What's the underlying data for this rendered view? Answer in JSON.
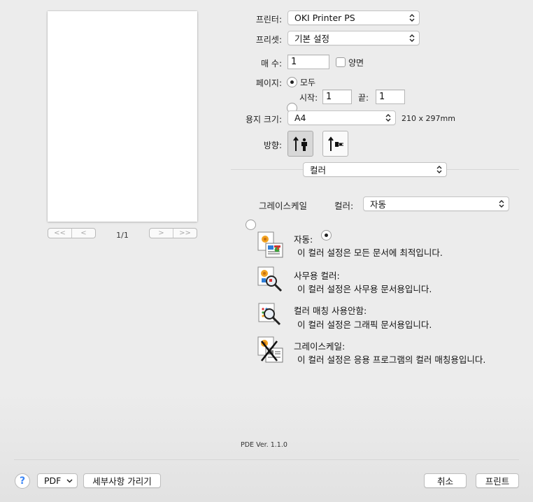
{
  "preview": {
    "page_indicator": "1/1",
    "first_label": "<<",
    "prev_label": "<",
    "next_label": ">",
    "last_label": ">>"
  },
  "printer": {
    "label": "프린터:",
    "value": "OKI Printer PS"
  },
  "preset": {
    "label": "프리셋:",
    "value": "기본 설정"
  },
  "copies": {
    "label": "매 수:",
    "value": "1",
    "duplex_label": "양면"
  },
  "pages": {
    "label": "페이지:",
    "all_label": "모두",
    "from_label": "시작:",
    "from_value": "1",
    "to_label": "끝:",
    "to_value": "1"
  },
  "paper": {
    "label": "용지 크기:",
    "value": "A4",
    "size_text": "210 x 297mm"
  },
  "orientation": {
    "label": "방향:"
  },
  "section": {
    "value": "컬러"
  },
  "color_mode": {
    "grayscale_label": "그레이스케일",
    "color_label": "컬러:",
    "color_value": "자동"
  },
  "descriptions": [
    {
      "title": "자동:",
      "body": "이 컬러 설정은 모든 문서에 최적입니다.",
      "icon": "auto-color-icon"
    },
    {
      "title": "사무용 컬러:",
      "body": "이 컬러 설정은 사무용 문서용입니다.",
      "icon": "office-color-icon"
    },
    {
      "title": "컬러 매칭 사용안함:",
      "body": "이 컬러 설정은 그래픽 문서용입니다.",
      "icon": "graphics-color-icon"
    },
    {
      "title": "그레이스케일:",
      "body": "이 컬러 설정은 응용 프로그램의 컬러 매칭용입니다.",
      "icon": "grayscale-icon"
    }
  ],
  "pde_version": "PDE Ver.  1.1.0",
  "footer": {
    "help_label": "?",
    "pdf_label": "PDF",
    "hide_details_label": "세부사항 가리기",
    "cancel_label": "취소",
    "print_label": "프린트"
  },
  "colors": {
    "accent": "#3b86f6",
    "background": "#ececec"
  }
}
